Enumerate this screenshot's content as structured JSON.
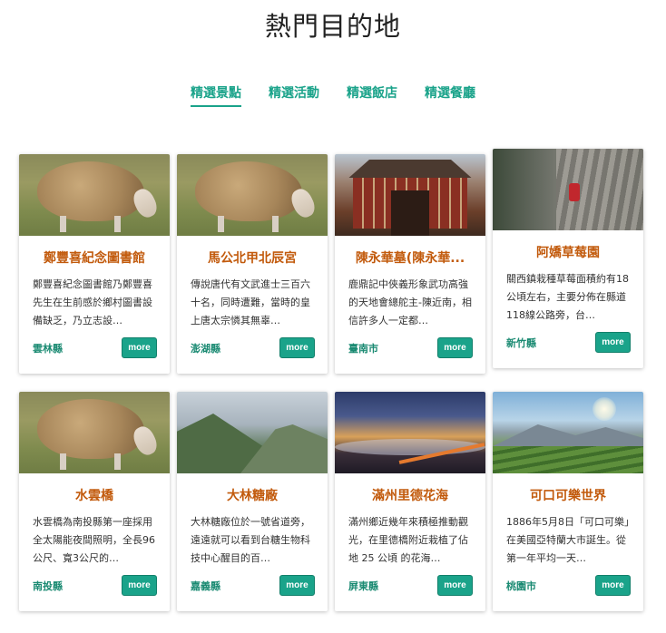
{
  "page": {
    "title": "熱門目的地"
  },
  "tabs": [
    {
      "label": "精選景點",
      "active": true
    },
    {
      "label": "精選活動",
      "active": false
    },
    {
      "label": "精選飯店",
      "active": false
    },
    {
      "label": "精選餐廳",
      "active": false
    }
  ],
  "colors": {
    "accent": "#1aa38a",
    "title_orange": "#c25a0c",
    "city_green": "#1a8a72"
  },
  "cards": [
    {
      "title": "鄭豐喜紀念圖書館",
      "desc": "鄭豐喜紀念圖書館乃鄭豐喜先生在生前感於鄉村圖書設備缺乏，乃立志設…",
      "city": "雲林縣",
      "button": "more",
      "image": "sheep-grazing-photo"
    },
    {
      "title": "馬公北甲北辰宮",
      "desc": "傳說唐代有文武進士三百六十名，同時遭難，當時的皇上唐太宗憐其無辜…",
      "city": "澎湖縣",
      "button": "more",
      "image": "sheep-grazing-photo"
    },
    {
      "title": "陳永華墓(陳永華...",
      "desc": "鹿鼎記中俠義形象武功高強的天地會總舵主-陳近南，相信許多人一定都…",
      "city": "臺南市",
      "button": "more",
      "image": "temple-gate-photo"
    },
    {
      "title": "阿嬌草莓園",
      "desc": "關西鎮栽種草莓面積約有18公頃左右，主要分佈在縣道118線公路旁，台…",
      "city": "新竹縣",
      "button": "more",
      "image": "rock-climber-photo"
    },
    {
      "title": "水雲橋",
      "desc": "水雲橋為南投縣第一座採用全太陽能夜間照明，全長96公尺、寬3公尺的…",
      "city": "南投縣",
      "button": "more",
      "image": "sheep-grazing-photo"
    },
    {
      "title": "大林糖廠",
      "desc": "大林糖廠位於一號省道旁，遠遠就可以看到台糖生物科技中心醒目的百…",
      "city": "嘉義縣",
      "button": "more",
      "image": "mountain-landscape-photo"
    },
    {
      "title": "滿州里德花海",
      "desc": "滿州鄉近幾年來積極推動觀光，在里德橋附近栽植了佔地 25 公頃 的花海…",
      "city": "屏東縣",
      "button": "more",
      "image": "sunset-cloud-sea-photo"
    },
    {
      "title": "可口可樂世界",
      "desc": "1886年5月8日「可口可樂」在美國亞特蘭大市誕生。從第一年平均一天…",
      "city": "桃園市",
      "button": "more",
      "image": "tea-plantation-photo"
    }
  ]
}
